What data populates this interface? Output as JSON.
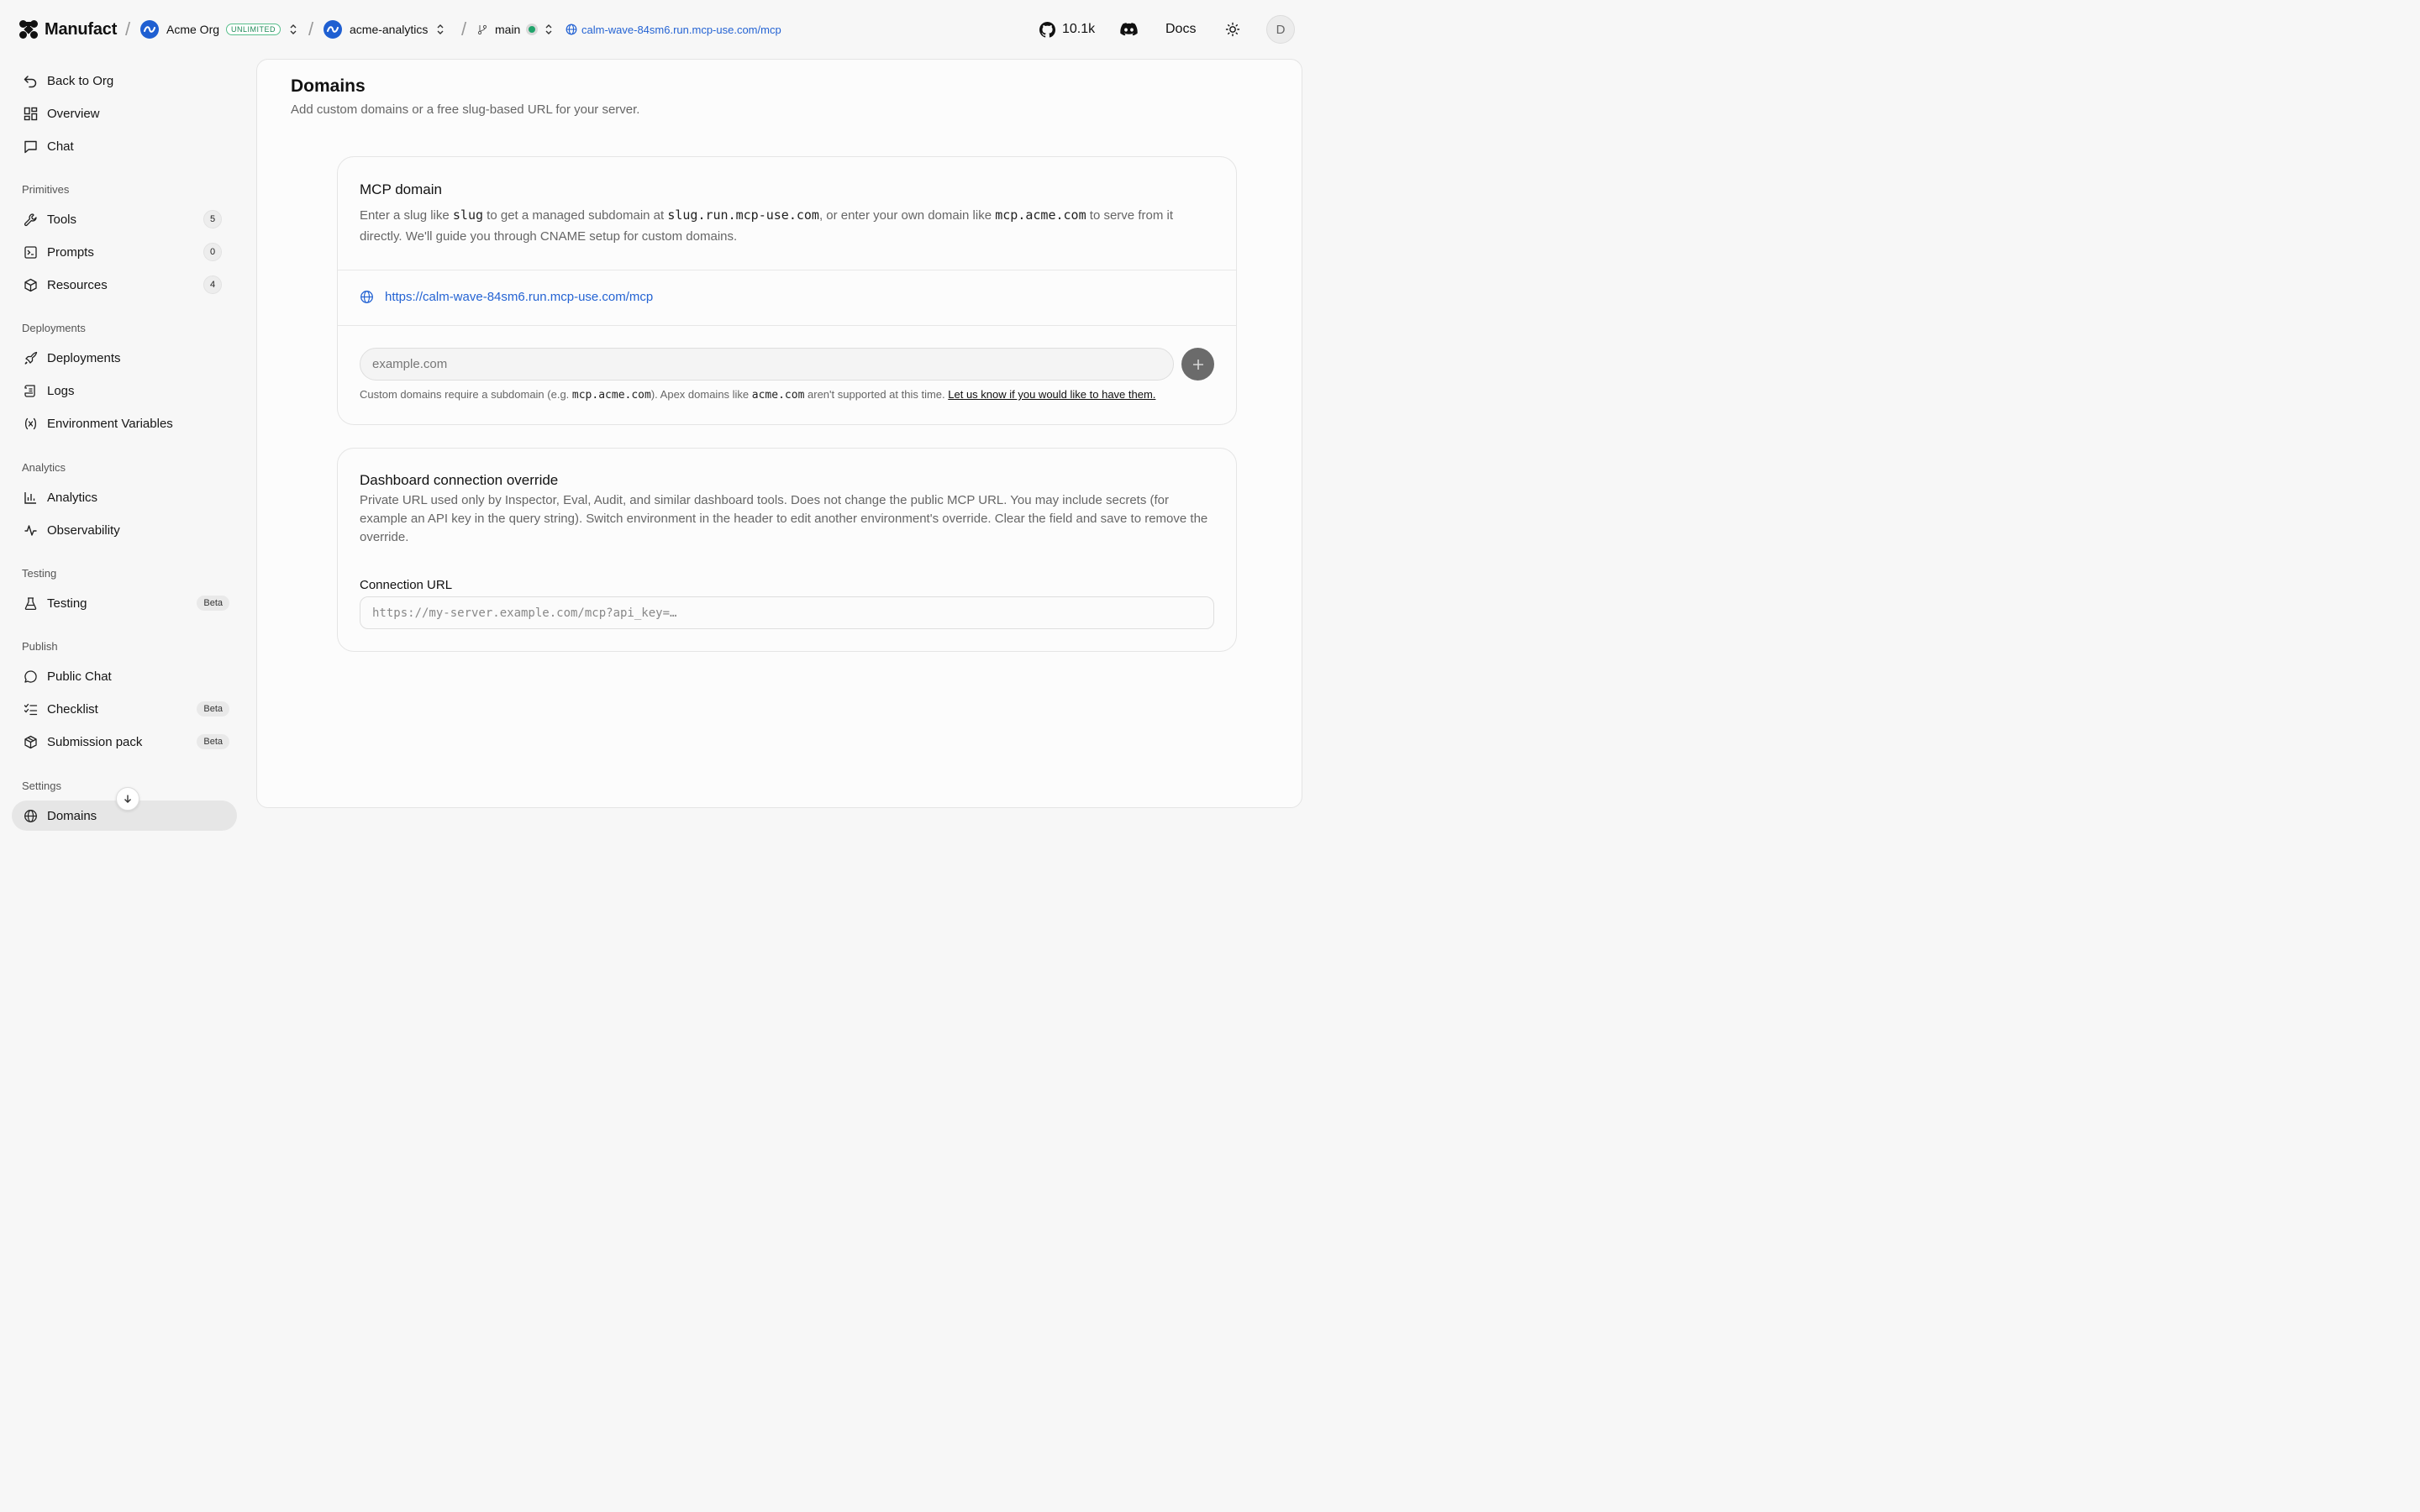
{
  "topbar": {
    "brand": "Manufact",
    "org_name": "Acme Org",
    "org_badge": "UNLIMITED",
    "project": "acme-analytics",
    "branch": "main",
    "server_url": "calm-wave-84sm6.run.mcp-use.com/mcp",
    "github_stars": "10.1k",
    "docs_label": "Docs",
    "user_initial": "D",
    "separator": "/"
  },
  "sidebar": {
    "top_items": [
      {
        "label": "Back to Org",
        "icon": "back-arrow-icon"
      },
      {
        "label": "Overview",
        "icon": "grid-icon"
      },
      {
        "label": "Chat",
        "icon": "chat-icon"
      }
    ],
    "sections": {
      "primitives": "Primitives",
      "deployments": "Deployments",
      "analytics": "Analytics",
      "testing": "Testing",
      "publish": "Publish",
      "settings": "Settings"
    },
    "primitives": [
      {
        "label": "Tools",
        "count": "5",
        "icon": "wrench-icon"
      },
      {
        "label": "Prompts",
        "count": "0",
        "icon": "terminal-icon"
      },
      {
        "label": "Resources",
        "count": "4",
        "icon": "box-icon"
      }
    ],
    "deployments": [
      {
        "label": "Deployments",
        "icon": "rocket-icon"
      },
      {
        "label": "Logs",
        "icon": "scroll-icon"
      },
      {
        "label": "Environment Variables",
        "icon": "variable-icon"
      }
    ],
    "analytics": [
      {
        "label": "Analytics",
        "icon": "bar-chart-icon"
      },
      {
        "label": "Observability",
        "icon": "activity-icon"
      }
    ],
    "testing": [
      {
        "label": "Testing",
        "badge": "Beta",
        "icon": "flask-icon"
      }
    ],
    "publish": [
      {
        "label": "Public Chat",
        "icon": "chat-bubble-icon"
      },
      {
        "label": "Checklist",
        "badge": "Beta",
        "icon": "checklist-icon"
      },
      {
        "label": "Submission pack",
        "badge": "Beta",
        "icon": "package-icon"
      }
    ],
    "settings": [
      {
        "label": "Domains",
        "icon": "globe-icon",
        "active": true
      }
    ]
  },
  "main": {
    "title": "Domains",
    "subtitle": "Add custom domains or a free slug-based URL for your server.",
    "mcp_card": {
      "title": "MCP domain",
      "desc_1": "Enter a slug like ",
      "desc_code_1": "slug",
      "desc_2": " to get a managed subdomain at ",
      "desc_code_2": "slug.run.mcp-use.com",
      "desc_3": ", or enter your own domain like ",
      "desc_code_3": "mcp.acme.com",
      "desc_4": " to serve from it directly. We'll guide you through CNAME setup for custom domains.",
      "domain_url": "https://calm-wave-84sm6.run.mcp-use.com/mcp",
      "input_placeholder": "example.com",
      "note_1": "Custom domains require a subdomain (e.g. ",
      "note_code_1": "mcp.acme.com",
      "note_2": "). Apex domains like ",
      "note_code_2": "acme.com",
      "note_3": " aren't supported at this time. ",
      "note_link": "Let us know if you would like to have them."
    },
    "override_card": {
      "title": "Dashboard connection override",
      "desc": "Private URL used only by Inspector, Eval, Audit, and similar dashboard tools. Does not change the public MCP URL. You may include secrets (for example an API key in the query string). Switch environment in the header to edit another environment's override. Clear the field and save to remove the override.",
      "field_label": "Connection URL",
      "input_placeholder": "https://my-server.example.com/mcp?api_key=…"
    }
  }
}
